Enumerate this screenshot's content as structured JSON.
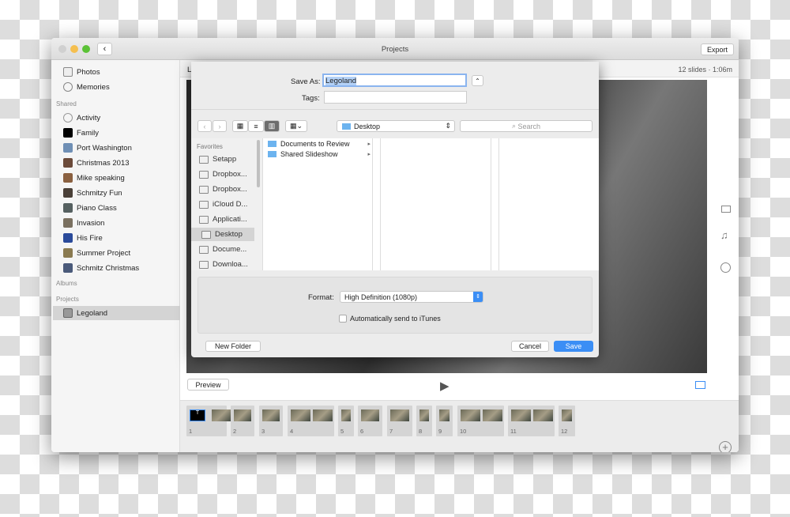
{
  "window": {
    "title": "Projects",
    "export_label": "Export"
  },
  "sidebar": {
    "top": [
      {
        "label": "Photos",
        "icon": "photos-icon"
      },
      {
        "label": "Memories",
        "icon": "memories-icon"
      }
    ],
    "shared_header": "Shared",
    "shared": [
      {
        "label": "Activity",
        "icon": "cloud-icon"
      },
      {
        "label": "Family",
        "color": "#000000"
      },
      {
        "label": "Port Washington",
        "color": "#6f8fb5"
      },
      {
        "label": "Christmas 2013",
        "color": "#6b4a3a"
      },
      {
        "label": "Mike speaking",
        "color": "#8a6040"
      },
      {
        "label": "Schmitzy Fun",
        "color": "#4a4038"
      },
      {
        "label": "Piano Class",
        "color": "#556060"
      },
      {
        "label": "Invasion",
        "color": "#7a7060"
      },
      {
        "label": "His Fire",
        "color": "#2a4a9a"
      },
      {
        "label": "Summer Project",
        "color": "#8a7a50"
      },
      {
        "label": "Schmitz Christmas",
        "color": "#4a5a7a"
      }
    ],
    "albums_header": "Albums",
    "projects_header": "Projects",
    "projects": [
      {
        "label": "Legoland",
        "selected": true
      }
    ]
  },
  "main": {
    "header_title": "L",
    "summary": "12 slides · 1:06m",
    "preview_label": "Preview",
    "clips": [
      "1",
      "2",
      "3",
      "4",
      "5",
      "6",
      "7",
      "8",
      "9",
      "10",
      "11",
      "12"
    ],
    "first_clip_text": "T"
  },
  "dialog": {
    "save_as_label": "Save As:",
    "save_as_value": "Legoland",
    "tags_label": "Tags:",
    "tags_value": "",
    "location": "Desktop",
    "search_placeholder": "Search",
    "favorites_header": "Favorites",
    "favorites": [
      {
        "label": "Setapp",
        "icon": "setapp-icon"
      },
      {
        "label": "Dropbox...",
        "icon": "folder-icon"
      },
      {
        "label": "Dropbox...",
        "icon": "folder-icon"
      },
      {
        "label": "iCloud D...",
        "icon": "cloud-icon"
      },
      {
        "label": "Applicati...",
        "icon": "applications-icon"
      },
      {
        "label": "Desktop",
        "icon": "desktop-icon",
        "selected": true
      },
      {
        "label": "Docume...",
        "icon": "documents-icon"
      },
      {
        "label": "Downloa...",
        "icon": "downloads-icon"
      }
    ],
    "files": [
      "Documents to Review",
      "Shared Slideshow"
    ],
    "format_label": "Format:",
    "format_value": "High Definition (1080p)",
    "itunes_label": "Automatically send to iTunes",
    "itunes_checked": false,
    "new_folder_label": "New Folder",
    "cancel_label": "Cancel",
    "save_label": "Save",
    "accent": "#3b8ef5"
  }
}
